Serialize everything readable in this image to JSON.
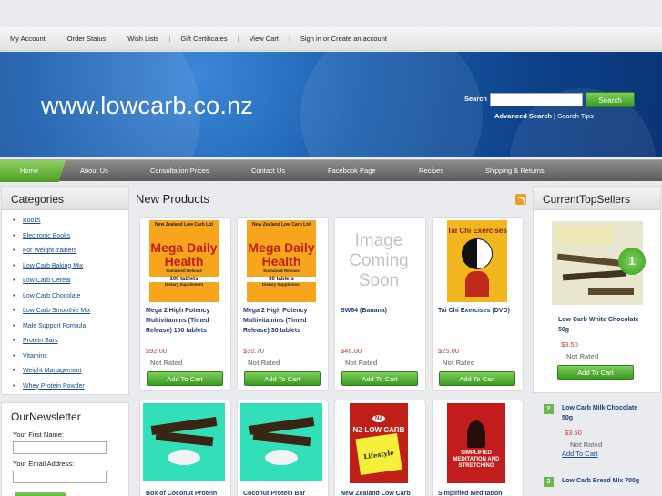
{
  "topbar": {
    "links": [
      "My Account",
      "Order Status",
      "Wish Lists",
      "Gift Certificates",
      "View Cart",
      "Sign in or Create an account"
    ]
  },
  "header": {
    "site_title": "www.lowcarb.co.nz",
    "search_label": "Search",
    "search_value": "",
    "search_button": "Search",
    "advanced_search": "Advanced Search",
    "search_tips": "Search Tips"
  },
  "nav": {
    "items": [
      "Home",
      "About Us",
      "Consultation Prices",
      "Contact Us",
      "Facebook Page",
      "Recipes",
      "Shipping & Returns"
    ]
  },
  "categories": {
    "title": "Categories",
    "items": [
      "Books",
      "Electronic Books",
      "For Weight trainers",
      "Low Carb Baking Mix",
      "Low Carb Cereal",
      "Low Carb Chocolate",
      "Low Carb Smoothie Mix",
      "Male Support Formula",
      "Protein Bars",
      "Vitamins",
      "Weight Management",
      "Whey Protein Powder"
    ]
  },
  "newsletter": {
    "title": "OurNewsletter",
    "first_name_label": "Your First Name:",
    "email_label": "Your Email Address:"
  },
  "new_products": {
    "title": "New Products",
    "not_rated": "Not Rated",
    "add_to_cart": "Add To Cart",
    "products": [
      {
        "name": "Mega 2 High Potency Multivitamins (Timed Release) 100 tablets",
        "price": "$92.00",
        "image": {
          "brand": "New Zealand Low Carb Ltd",
          "title": "Mega Daily Health",
          "sub": "Sustained Release",
          "count": "100 tablets",
          "desc": "Dietary Supplement"
        }
      },
      {
        "name": "Mega 2 High Potency Multivitamins (Timed Release) 30 tablets",
        "price": "$30.70",
        "image": {
          "brand": "New Zealand Low Carb Ltd",
          "title": "Mega Daily Health",
          "sub": "Sustained Release",
          "count": "30 tablets",
          "desc": "Dietary Supplement"
        }
      },
      {
        "name": "SW64 (Banana)",
        "price": "$46.00",
        "image": {
          "text": "Image Coming Soon"
        }
      },
      {
        "name": "Tai Chi Exercises (DVD)",
        "price": "$25.00",
        "image": {
          "title": "Tai Chi Exercises"
        }
      },
      {
        "name": "Box of Coconut Protein",
        "price": "",
        "image": {}
      },
      {
        "name": "Coconut Protein Bar",
        "price": "",
        "image": {}
      },
      {
        "name": "New Zealand Low Carb",
        "price": "",
        "image": {
          "badge": "NZ",
          "title": "NZ LOW CARB",
          "sticky": "Lifestyle"
        }
      },
      {
        "name": "Simplified Meditation",
        "price": "",
        "image": {
          "title": "SIMPLIFIED MEDITATION AND STRETCHING"
        }
      }
    ]
  },
  "top_sellers": {
    "title": "CurrentTopSellers",
    "first": {
      "rank": "1",
      "name": "Low Carb White Chocolate 50g",
      "price": "$3.50",
      "rated": "Not Rated",
      "cart": "Add To Cart"
    },
    "others": [
      {
        "rank": "2",
        "name": "Low Carb Milk Chocolate 50g",
        "price": "$3.60",
        "rated": "Not Rated",
        "cart": "Add To Cart"
      },
      {
        "rank": "3",
        "name": "Low Carb Bread Mix 700g"
      }
    ]
  }
}
